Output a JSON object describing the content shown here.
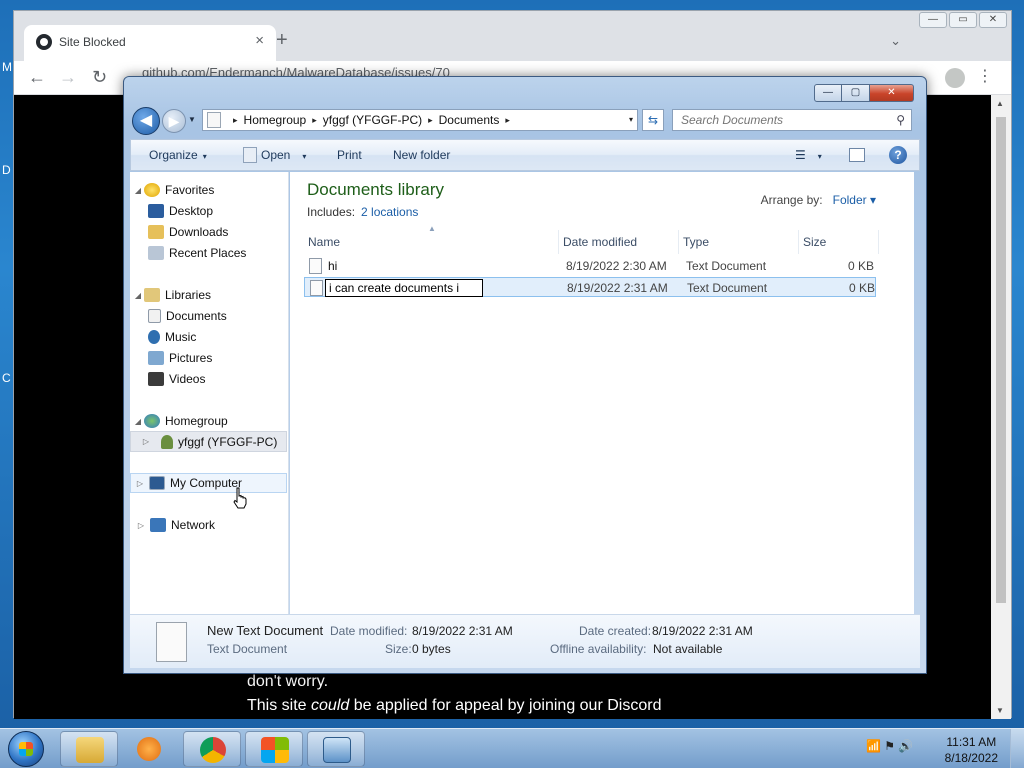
{
  "browser": {
    "tab_title": "Site Blocked",
    "tab_close": "×",
    "new_tab": "+",
    "tab_menu": "⌄",
    "url": "github.com/Endermanch/MalwareDatabase/issues/70",
    "back": "←",
    "forward": "→",
    "reload": "↻",
    "menu": "⋮",
    "window_min": "—",
    "window_max": "▭",
    "window_close": "✕",
    "page_text_1": "don't worry.",
    "page_text_2_pre": "This site ",
    "page_text_2_em": "could",
    "page_text_2_post": " be applied for appeal by joining our Discord"
  },
  "desktop_fragments": [
    "M",
    "D",
    "C"
  ],
  "explorer": {
    "caption": {
      "minimize": "—",
      "maximize": "▢",
      "close": "✕"
    },
    "address": {
      "crumbs": [
        "Homegroup",
        "yfggf (YFGGF-PC)",
        "Documents"
      ],
      "separator": "▸",
      "dropdown": "▾"
    },
    "search": {
      "placeholder": "Search Documents",
      "icon": "search-icon"
    },
    "commands": {
      "organize": "Organize",
      "open": "Open",
      "print": "Print",
      "new_folder": "New folder",
      "caret": "▾",
      "views": "☰",
      "help": "?"
    },
    "nav": {
      "favorites": "Favorites",
      "desktop": "Desktop",
      "downloads": "Downloads",
      "recent_places": "Recent Places",
      "libraries": "Libraries",
      "documents": "Documents",
      "music": "Music",
      "pictures": "Pictures",
      "videos": "Videos",
      "homegroup": "Homegroup",
      "homegroup_user": "yfggf (YFGGF-PC)",
      "my_computer": "My Computer",
      "network": "Network",
      "expand_glyph": "◢",
      "collapsed_glyph": "▷"
    },
    "library": {
      "title": "Documents library",
      "includes_label": "Includes:",
      "includes_link": "2 locations",
      "arrange_label": "Arrange by:",
      "arrange_value": "Folder ▾"
    },
    "columns": [
      "Name",
      "Date modified",
      "Type",
      "Size"
    ],
    "files": [
      {
        "name": "hi",
        "date": "8/19/2022 2:30 AM",
        "type": "Text Document",
        "size": "0 KB"
      },
      {
        "name": "i can create documents i",
        "date": "8/19/2022 2:31 AM",
        "type": "Text Document",
        "size": "0 KB"
      }
    ],
    "details": {
      "name": "New Text Document",
      "kind": "Text Document",
      "date_modified_label": "Date modified:",
      "date_modified": "8/19/2022 2:31 AM",
      "size_label": "Size:",
      "size": "0 bytes",
      "date_created_label": "Date created:",
      "date_created": "8/19/2022 2:31 AM",
      "offline_label": "Offline availability:",
      "offline": "Not available"
    }
  },
  "taskbar": {
    "clock_time": "11:31 AM",
    "clock_date": "8/18/2022",
    "tray_icons": [
      "network-icon",
      "flag-icon",
      "volume-icon"
    ],
    "tray_text": "📶 ⚑ 🔊"
  },
  "colors": {
    "library_title": "#1e5e19",
    "link": "#1b5ea7",
    "selection": "#e1eefb"
  }
}
